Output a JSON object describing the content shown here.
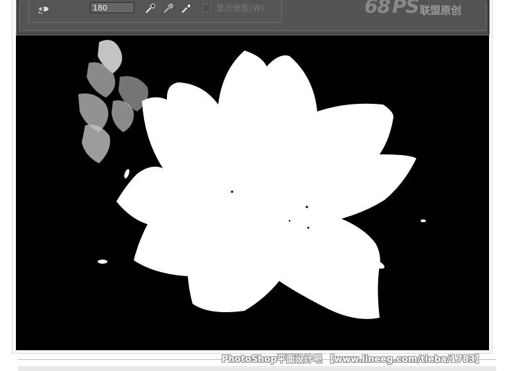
{
  "toolbar": {
    "value": "180",
    "show_clip_label": "显示修剪(W)",
    "show_clip_checked": false,
    "icons": [
      "refine-brush-icon",
      "eyedropper-black-icon",
      "eyedropper-gray-icon",
      "eyedropper-white-icon"
    ]
  },
  "watermark": {
    "logo_number": "68",
    "logo_ps": "PS",
    "logo_text": "联盟原创"
  },
  "canvas": {
    "background": "#000000",
    "subject": "#ffffff"
  },
  "caption": {
    "text": "PhotoShop平面设计吧 【www.lineeg.com/tieba/1783】"
  }
}
